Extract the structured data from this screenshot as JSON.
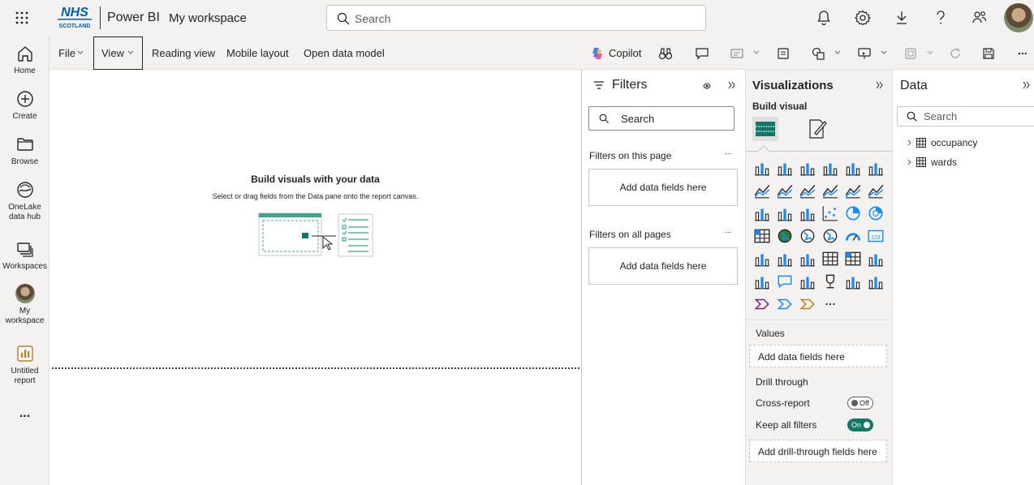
{
  "topbar": {
    "org_logo_top": "NHS",
    "org_logo_bottom": "SCOTLAND",
    "app_name": "Power BI",
    "workspace_name": "My workspace",
    "search_placeholder": "Search",
    "icons": [
      "bell-icon",
      "gear-icon",
      "download-icon",
      "help-icon",
      "share-icon",
      "profile-avatar"
    ]
  },
  "leftnav": {
    "items": [
      {
        "label": "Home",
        "icon": "home-icon"
      },
      {
        "label": "Create",
        "icon": "plus-circle-icon"
      },
      {
        "label": "Browse",
        "icon": "folder-icon"
      },
      {
        "label": "OneLake data hub",
        "label_line1": "OneLake",
        "label_line2": "data hub",
        "icon": "onelake-icon"
      },
      {
        "label": "Workspaces",
        "icon": "workspaces-icon"
      },
      {
        "label": "My workspace",
        "label_line1": "My",
        "label_line2": "workspace",
        "icon": "avatar"
      },
      {
        "label": "Untitled report",
        "label_line1": "Untitled",
        "label_line2": "report",
        "icon": "report-icon"
      }
    ],
    "more": "..."
  },
  "ribbon": {
    "file": "File",
    "view": "View",
    "reading_view": "Reading view",
    "mobile_layout": "Mobile layout",
    "open_data_model": "Open data model",
    "copilot": "Copilot",
    "more": "..."
  },
  "canvas": {
    "title": "Build visuals with your data",
    "subtitle": "Select or drag fields from the Data pane onto the report canvas."
  },
  "filters": {
    "title": "Filters",
    "search_placeholder": "Search",
    "this_page": "Filters on this page",
    "all_pages": "Filters on all pages",
    "add_fields": "Add data fields here",
    "more": "..."
  },
  "visualizations": {
    "title": "Visualizations",
    "build_visual": "Build visual",
    "values_label": "Values",
    "values_add": "Add data fields here",
    "drill_through": "Drill through",
    "cross_report": "Cross-report",
    "cross_report_state": "Off",
    "keep_filters": "Keep all filters",
    "keep_filters_state": "On",
    "drill_add": "Add drill-through fields here",
    "more_visuals": "..."
  },
  "data": {
    "title": "Data",
    "search_placeholder": "Search",
    "tables": [
      "occupancy",
      "wards"
    ]
  },
  "colors": {
    "accent_green": "#117865",
    "teal": "#0f7c6f",
    "blue": "#118dff"
  }
}
